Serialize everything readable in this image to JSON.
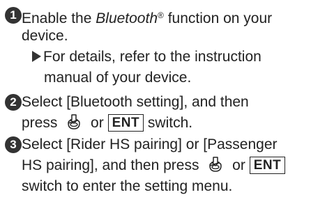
{
  "step1": {
    "number": "1",
    "part_a": "Enable the ",
    "bluetooth": "Bluetooth",
    "reg": "®",
    "part_b": " function on your",
    "line2": "device.",
    "note_line1": "For details, refer to the instruction",
    "note_line2": "manual of your device."
  },
  "step2": {
    "number": "2",
    "line1": "Select [Bluetooth setting], and then",
    "press": "press",
    "or": "or",
    "ent": "ENT",
    "switch": "switch."
  },
  "step3": {
    "number": "3",
    "line1": "Select [Rider HS pairing] or [Passenger",
    "line2_a": "HS pairing], and then press",
    "or": "or",
    "ent": "ENT",
    "line3": "switch to enter the setting menu."
  },
  "icons": {
    "joystick": "joystick-push-icon",
    "arrow": "triangle-arrow-icon"
  },
  "colors": {
    "text": "#222222",
    "badge": "#333333"
  }
}
